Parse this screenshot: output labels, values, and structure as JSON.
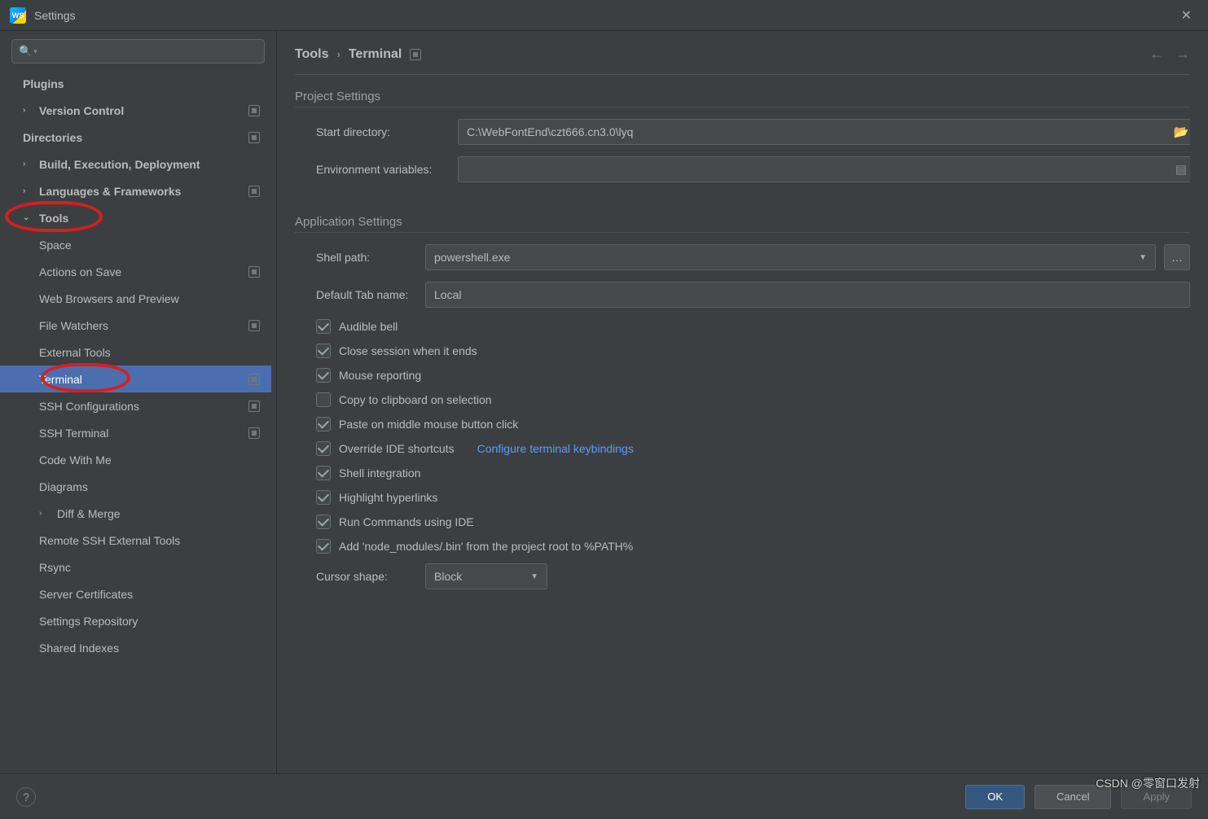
{
  "window": {
    "title": "Settings",
    "app_icon_label": "WS"
  },
  "sidebar": {
    "search_placeholder": "",
    "items": [
      {
        "label": "Plugins",
        "level": 0,
        "bold": true
      },
      {
        "label": "Version Control",
        "level": 0,
        "bold": true,
        "expander": "›",
        "badge": true
      },
      {
        "label": "Directories",
        "level": 0,
        "bold": true,
        "badge": true
      },
      {
        "label": "Build, Execution, Deployment",
        "level": 0,
        "bold": true,
        "expander": "›"
      },
      {
        "label": "Languages & Frameworks",
        "level": 0,
        "bold": true,
        "expander": "›",
        "badge": true
      },
      {
        "label": "Tools",
        "level": 0,
        "bold": true,
        "expander": "⌄",
        "annotated": true
      },
      {
        "label": "Space",
        "level": 1
      },
      {
        "label": "Actions on Save",
        "level": 1,
        "badge": true
      },
      {
        "label": "Web Browsers and Preview",
        "level": 1
      },
      {
        "label": "File Watchers",
        "level": 1,
        "badge": true
      },
      {
        "label": "External Tools",
        "level": 1
      },
      {
        "label": "Terminal",
        "level": 1,
        "selected": true,
        "badge": true,
        "annotated": true
      },
      {
        "label": "SSH Configurations",
        "level": 1,
        "badge": true
      },
      {
        "label": "SSH Terminal",
        "level": 1,
        "badge": true
      },
      {
        "label": "Code With Me",
        "level": 1
      },
      {
        "label": "Diagrams",
        "level": 1
      },
      {
        "label": "Diff & Merge",
        "level": 1,
        "expander": "›"
      },
      {
        "label": "Remote SSH External Tools",
        "level": 1
      },
      {
        "label": "Rsync",
        "level": 1
      },
      {
        "label": "Server Certificates",
        "level": 1
      },
      {
        "label": "Settings Repository",
        "level": 1
      },
      {
        "label": "Shared Indexes",
        "level": 1
      }
    ]
  },
  "breadcrumb": {
    "parent": "Tools",
    "current": "Terminal"
  },
  "project_settings": {
    "section_title": "Project Settings",
    "start_directory_label": "Start directory:",
    "start_directory_value": "C:\\WebFontEnd\\czt666.cn3.0\\lyq",
    "env_vars_label": "Environment variables:",
    "env_vars_value": ""
  },
  "app_settings": {
    "section_title": "Application Settings",
    "shell_path_label": "Shell path:",
    "shell_path_value": "powershell.exe",
    "default_tab_label": "Default Tab name:",
    "default_tab_value": "Local",
    "checkboxes": [
      {
        "label": "Audible bell",
        "checked": true
      },
      {
        "label": "Close session when it ends",
        "checked": true
      },
      {
        "label": "Mouse reporting",
        "checked": true
      },
      {
        "label": "Copy to clipboard on selection",
        "checked": false
      },
      {
        "label": "Paste on middle mouse button click",
        "checked": true
      },
      {
        "label": "Override IDE shortcuts",
        "checked": true,
        "link": "Configure terminal keybindings"
      },
      {
        "label": "Shell integration",
        "checked": true
      },
      {
        "label": "Highlight hyperlinks",
        "checked": true
      },
      {
        "label": "Run Commands using IDE",
        "checked": true
      },
      {
        "label": "Add 'node_modules/.bin' from the project root to %PATH%",
        "checked": true
      }
    ],
    "cursor_shape_label": "Cursor shape:",
    "cursor_shape_value": "Block"
  },
  "footer": {
    "ok": "OK",
    "cancel": "Cancel",
    "apply": "Apply"
  },
  "watermark": "CSDN @零窗口发射"
}
